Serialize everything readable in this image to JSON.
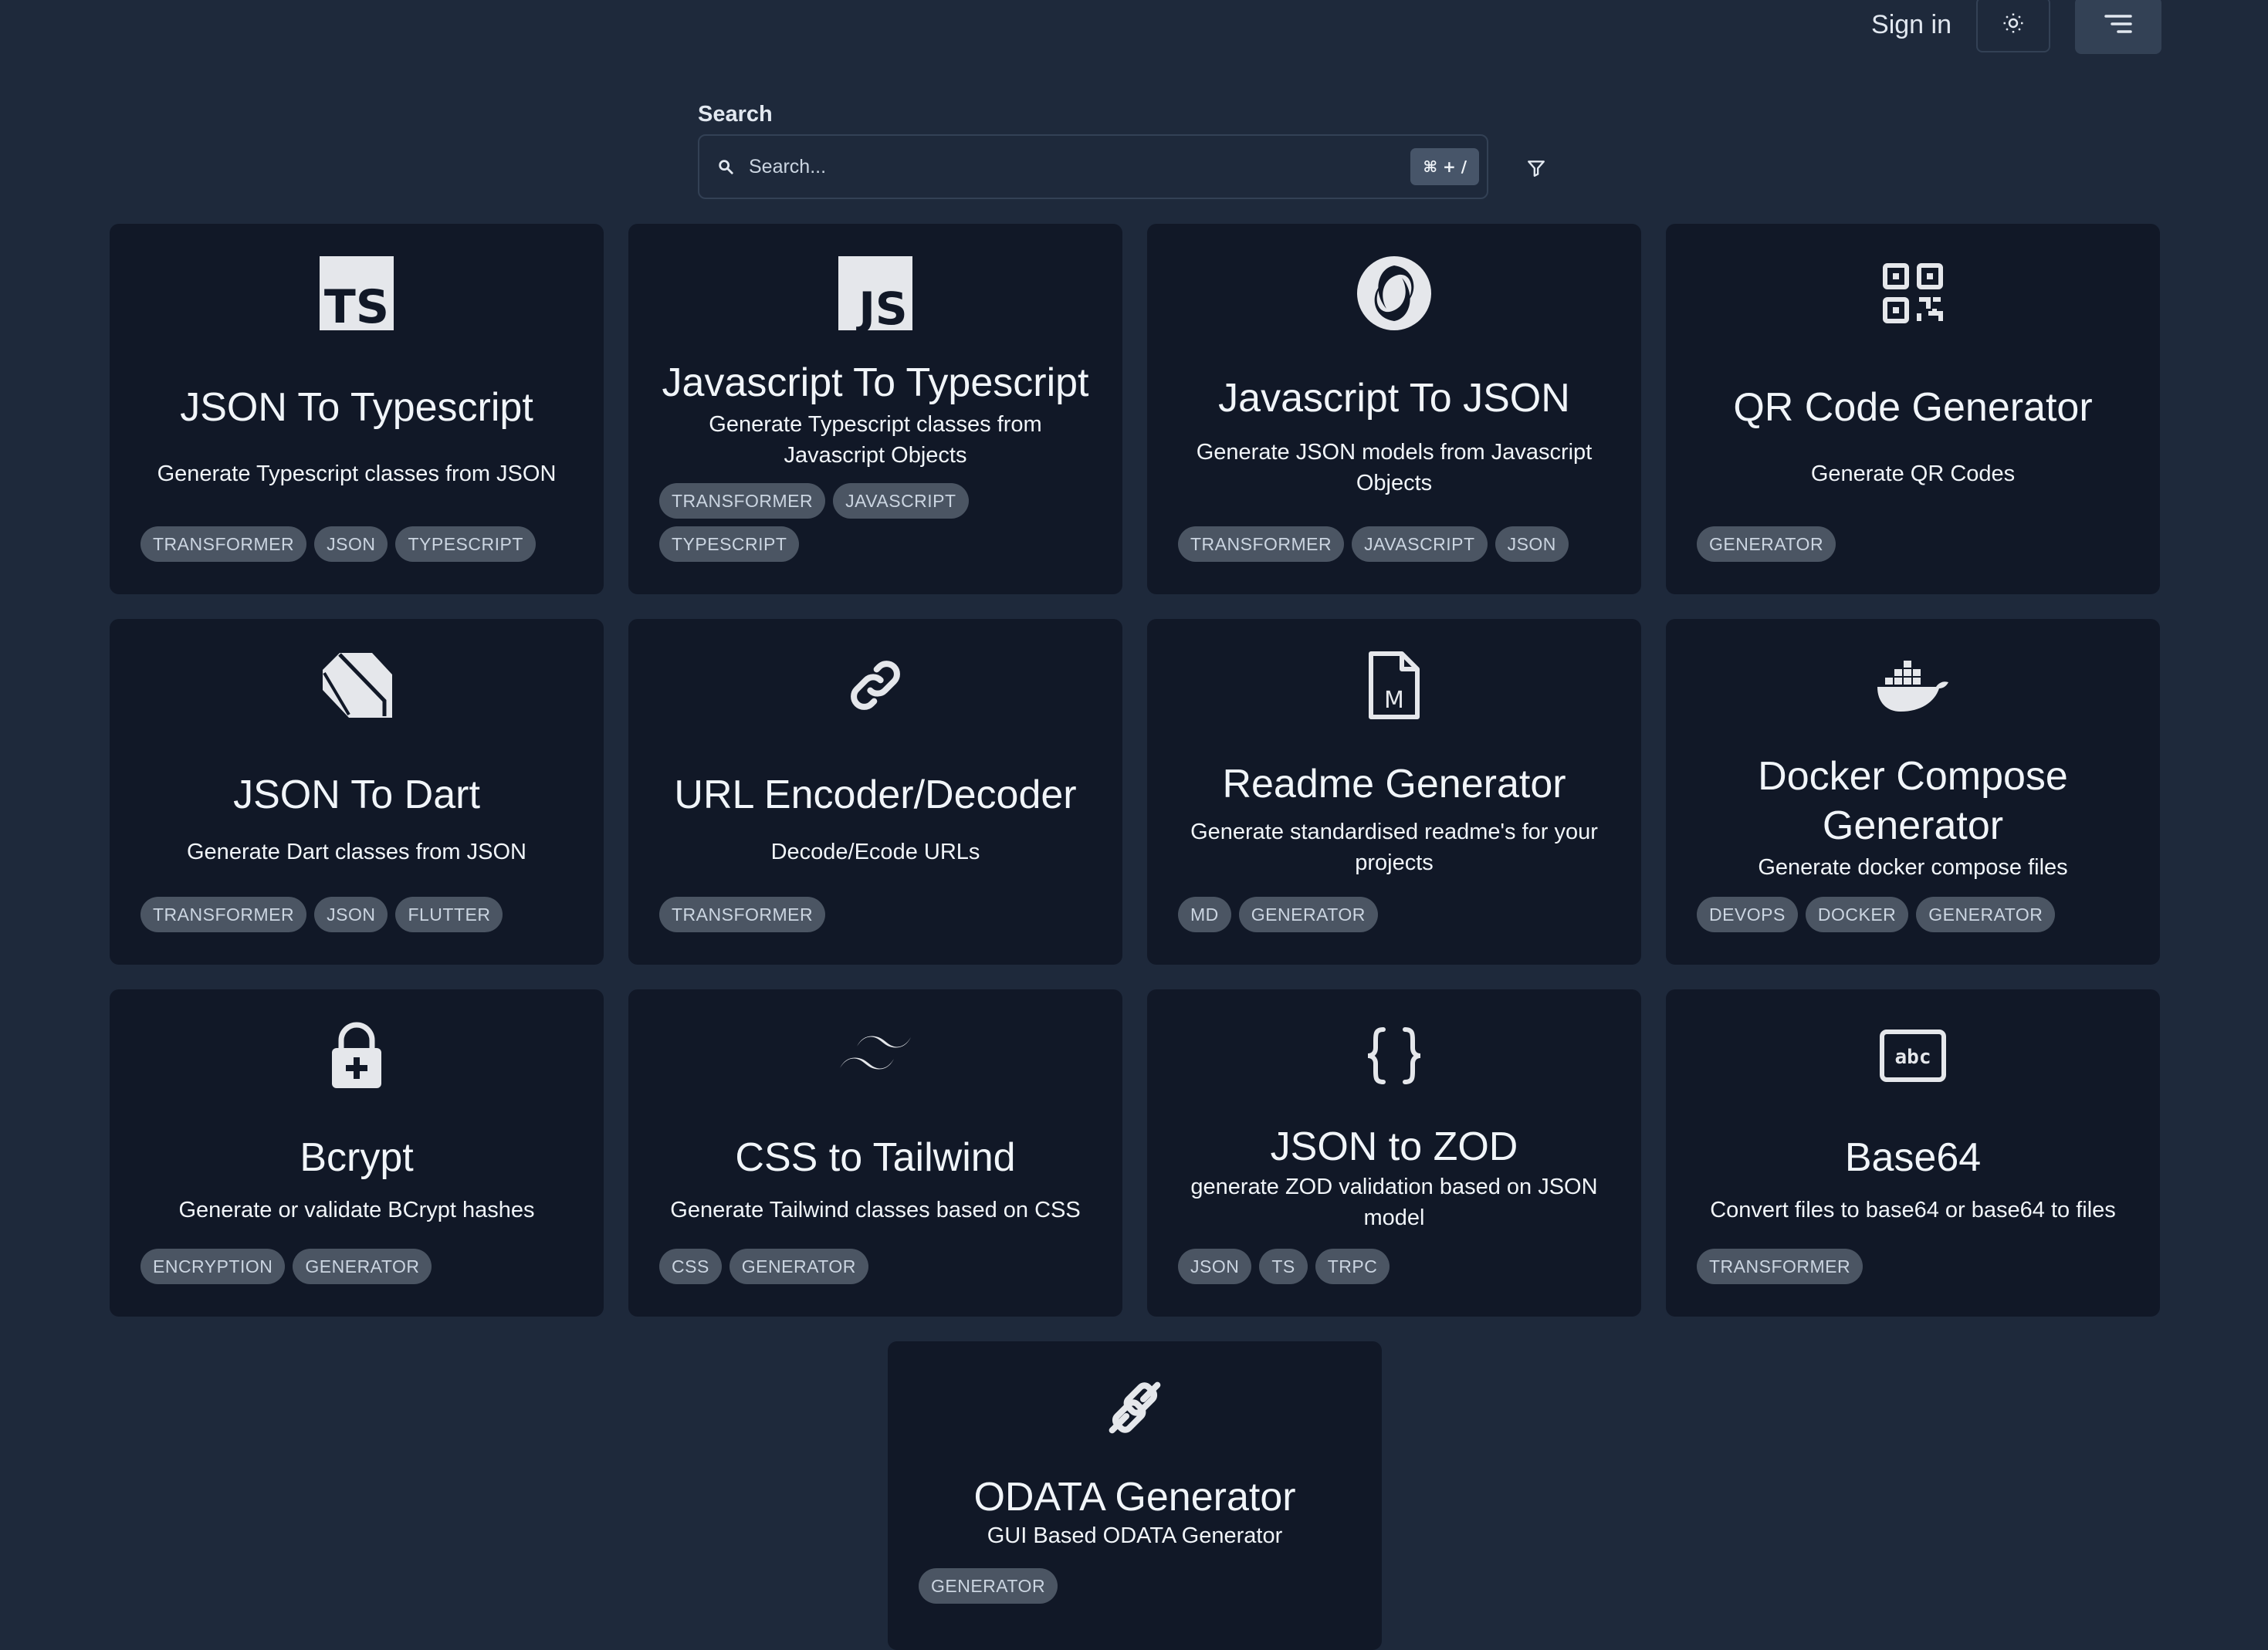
{
  "header": {
    "signin_label": "Sign in"
  },
  "search": {
    "label": "Search",
    "placeholder": "Search...",
    "shortcut": "⌘ + /"
  },
  "colors": {
    "page_bg": "#1e293b",
    "card_bg": "#111827",
    "tag_bg": "#4b5563",
    "text": "#f1f5f9"
  },
  "cards": [
    {
      "icon": "typescript-icon",
      "title": "JSON To Typescript",
      "desc": "Generate Typescript classes from JSON",
      "tags": [
        "TRANSFORMER",
        "JSON",
        "TYPESCRIPT"
      ]
    },
    {
      "icon": "javascript-icon",
      "title": "Javascript To Typescript",
      "desc": "Generate Typescript classes from Javascript Objects",
      "tags": [
        "TRANSFORMER",
        "JAVASCRIPT",
        "TYPESCRIPT"
      ]
    },
    {
      "icon": "json-logo-icon",
      "title": "Javascript To JSON",
      "desc": "Generate JSON models from Javascript Objects",
      "tags": [
        "TRANSFORMER",
        "JAVASCRIPT",
        "JSON"
      ]
    },
    {
      "icon": "qr-code-icon",
      "title": "QR Code Generator",
      "desc": "Generate QR Codes",
      "tags": [
        "GENERATOR"
      ]
    },
    {
      "icon": "dart-icon",
      "title": "JSON To Dart",
      "desc": "Generate Dart classes from JSON",
      "tags": [
        "TRANSFORMER",
        "JSON",
        "FLUTTER"
      ]
    },
    {
      "icon": "link-icon",
      "title": "URL Encoder/Decoder",
      "desc": "Decode/Ecode URLs",
      "tags": [
        "TRANSFORMER"
      ]
    },
    {
      "icon": "markdown-file-icon",
      "title": "Readme Generator",
      "desc": "Generate standardised readme's for your projects",
      "tags": [
        "MD",
        "GENERATOR"
      ]
    },
    {
      "icon": "docker-icon",
      "title": "Docker Compose Generator",
      "desc": "Generate docker compose files",
      "tags": [
        "DEVOPS",
        "DOCKER",
        "GENERATOR"
      ]
    },
    {
      "icon": "lock-plus-icon",
      "title": "Bcrypt",
      "desc": "Generate or validate BCrypt hashes",
      "tags": [
        "ENCRYPTION",
        "GENERATOR"
      ]
    },
    {
      "icon": "tailwind-icon",
      "title": "CSS to Tailwind",
      "desc": "Generate Tailwind classes based on CSS",
      "tags": [
        "CSS",
        "GENERATOR"
      ]
    },
    {
      "icon": "curly-braces-icon",
      "title": "JSON to ZOD",
      "desc": "generate ZOD validation based on JSON model",
      "tags": [
        "JSON",
        "TS",
        "TRPC"
      ]
    },
    {
      "icon": "abc-box-icon",
      "title": "Base64",
      "desc": "Convert files to base64 or base64 to files",
      "tags": [
        "TRANSFORMER"
      ]
    },
    {
      "icon": "plug-icon",
      "title": "ODATA Generator",
      "desc": "GUI Based ODATA Generator",
      "tags": [
        "GENERATOR"
      ]
    }
  ]
}
